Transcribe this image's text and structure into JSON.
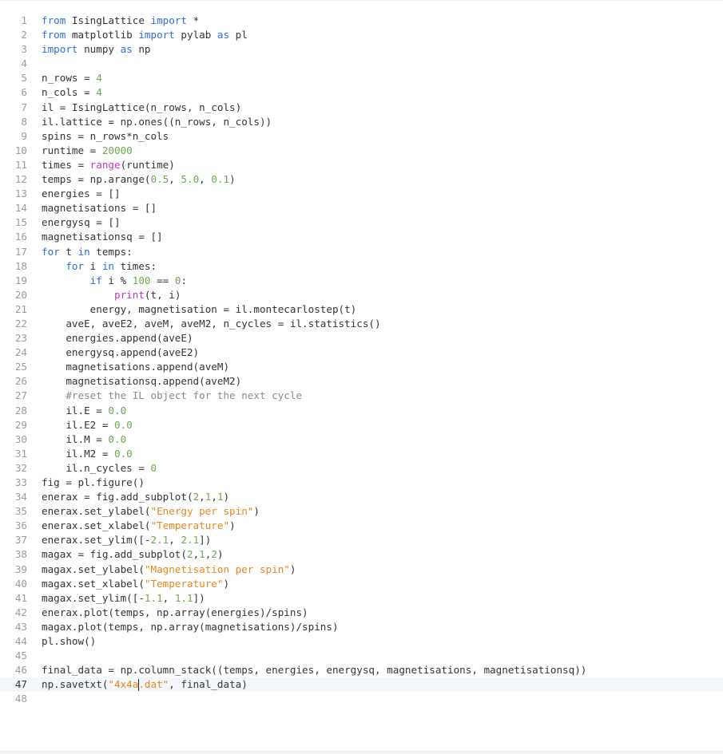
{
  "editor": {
    "cursor_line": 47,
    "colors": {
      "keyword": "#2d6cdf",
      "builtin": "#c535c5",
      "number": "#6aa84f",
      "string": "#e8861b",
      "comment": "#8a8a8a",
      "text": "#333333",
      "line_number": "#9a9a9a",
      "active_line_bg": "#f3f6fa"
    },
    "lines": [
      [
        [
          "kw",
          "from"
        ],
        [
          "t",
          " IsingLattice "
        ],
        [
          "kw",
          "import"
        ],
        [
          "t",
          " *"
        ]
      ],
      [
        [
          "kw",
          "from"
        ],
        [
          "t",
          " matplotlib "
        ],
        [
          "kw",
          "import"
        ],
        [
          "t",
          " pylab "
        ],
        [
          "kw",
          "as"
        ],
        [
          "t",
          " pl"
        ]
      ],
      [
        [
          "kw",
          "import"
        ],
        [
          "t",
          " numpy "
        ],
        [
          "kw",
          "as"
        ],
        [
          "t",
          " np"
        ]
      ],
      [],
      [
        [
          "t",
          "n_rows = "
        ],
        [
          "num",
          "4"
        ]
      ],
      [
        [
          "t",
          "n_cols = "
        ],
        [
          "num",
          "4"
        ]
      ],
      [
        [
          "t",
          "il = IsingLattice(n_rows, n_cols)"
        ]
      ],
      [
        [
          "t",
          "il.lattice = np.ones((n_rows, n_cols))"
        ]
      ],
      [
        [
          "t",
          "spins = n_rows*n_cols"
        ]
      ],
      [
        [
          "t",
          "runtime = "
        ],
        [
          "num",
          "20000"
        ]
      ],
      [
        [
          "t",
          "times = "
        ],
        [
          "bi",
          "range"
        ],
        [
          "t",
          "(runtime)"
        ]
      ],
      [
        [
          "t",
          "temps = np.arange("
        ],
        [
          "num",
          "0.5"
        ],
        [
          "t",
          ", "
        ],
        [
          "num",
          "5.0"
        ],
        [
          "t",
          ", "
        ],
        [
          "num",
          "0.1"
        ],
        [
          "t",
          ")"
        ]
      ],
      [
        [
          "t",
          "energies = []"
        ]
      ],
      [
        [
          "t",
          "magnetisations = []"
        ]
      ],
      [
        [
          "t",
          "energysq = []"
        ]
      ],
      [
        [
          "t",
          "magnetisationsq = []"
        ]
      ],
      [
        [
          "kw",
          "for"
        ],
        [
          "t",
          " t "
        ],
        [
          "kw",
          "in"
        ],
        [
          "t",
          " temps:"
        ]
      ],
      [
        [
          "t",
          "    "
        ],
        [
          "kw",
          "for"
        ],
        [
          "t",
          " i "
        ],
        [
          "kw",
          "in"
        ],
        [
          "t",
          " times:"
        ]
      ],
      [
        [
          "t",
          "        "
        ],
        [
          "kw",
          "if"
        ],
        [
          "t",
          " i % "
        ],
        [
          "num",
          "100"
        ],
        [
          "t",
          " == "
        ],
        [
          "num",
          "0"
        ],
        [
          "t",
          ":"
        ]
      ],
      [
        [
          "t",
          "            "
        ],
        [
          "bi",
          "print"
        ],
        [
          "t",
          "(t, i)"
        ]
      ],
      [
        [
          "t",
          "        energy, magnetisation = il.montecarlostep(t)"
        ]
      ],
      [
        [
          "t",
          "    aveE, aveE2, aveM, aveM2, n_cycles = il.statistics()"
        ]
      ],
      [
        [
          "t",
          "    energies.append(aveE)"
        ]
      ],
      [
        [
          "t",
          "    energysq.append(aveE2)"
        ]
      ],
      [
        [
          "t",
          "    magnetisations.append(aveM)"
        ]
      ],
      [
        [
          "t",
          "    magnetisationsq.append(aveM2)"
        ]
      ],
      [
        [
          "t",
          "    "
        ],
        [
          "cmt",
          "#reset the IL object for the next cycle"
        ]
      ],
      [
        [
          "t",
          "    il.E = "
        ],
        [
          "num",
          "0.0"
        ]
      ],
      [
        [
          "t",
          "    il.E2 = "
        ],
        [
          "num",
          "0.0"
        ]
      ],
      [
        [
          "t",
          "    il.M = "
        ],
        [
          "num",
          "0.0"
        ]
      ],
      [
        [
          "t",
          "    il.M2 = "
        ],
        [
          "num",
          "0.0"
        ]
      ],
      [
        [
          "t",
          "    il.n_cycles = "
        ],
        [
          "num",
          "0"
        ]
      ],
      [
        [
          "t",
          "fig = pl.figure()"
        ]
      ],
      [
        [
          "t",
          "enerax = fig.add_subplot("
        ],
        [
          "num",
          "2"
        ],
        [
          "t",
          ","
        ],
        [
          "num",
          "1"
        ],
        [
          "t",
          ","
        ],
        [
          "num",
          "1"
        ],
        [
          "t",
          ")"
        ]
      ],
      [
        [
          "t",
          "enerax.set_ylabel("
        ],
        [
          "str",
          "\"Energy per spin\""
        ],
        [
          "t",
          ")"
        ]
      ],
      [
        [
          "t",
          "enerax.set_xlabel("
        ],
        [
          "str",
          "\"Temperature\""
        ],
        [
          "t",
          ")"
        ]
      ],
      [
        [
          "t",
          "enerax.set_ylim([-"
        ],
        [
          "num",
          "2.1"
        ],
        [
          "t",
          ", "
        ],
        [
          "num",
          "2.1"
        ],
        [
          "t",
          "])"
        ]
      ],
      [
        [
          "t",
          "magax = fig.add_subplot("
        ],
        [
          "num",
          "2"
        ],
        [
          "t",
          ","
        ],
        [
          "num",
          "1"
        ],
        [
          "t",
          ","
        ],
        [
          "num",
          "2"
        ],
        [
          "t",
          ")"
        ]
      ],
      [
        [
          "t",
          "magax.set_ylabel("
        ],
        [
          "str",
          "\"Magnetisation per spin\""
        ],
        [
          "t",
          ")"
        ]
      ],
      [
        [
          "t",
          "magax.set_xlabel("
        ],
        [
          "str",
          "\"Temperature\""
        ],
        [
          "t",
          ")"
        ]
      ],
      [
        [
          "t",
          "magax.set_ylim([-"
        ],
        [
          "num",
          "1.1"
        ],
        [
          "t",
          ", "
        ],
        [
          "num",
          "1.1"
        ],
        [
          "t",
          "])"
        ]
      ],
      [
        [
          "t",
          "enerax.plot(temps, np.array(energies)/spins)"
        ]
      ],
      [
        [
          "t",
          "magax.plot(temps, np.array(magnetisations)/spins)"
        ]
      ],
      [
        [
          "t",
          "pl.show()"
        ]
      ],
      [],
      [
        [
          "t",
          "final_data = np.column_stack((temps, energies, energysq, magnetisations, magnetisationsq))"
        ]
      ],
      [
        [
          "t",
          "np.savetxt("
        ],
        [
          "str",
          "\"4x4a"
        ],
        [
          "cursor",
          ""
        ],
        [
          "str",
          ".dat\""
        ],
        [
          "t",
          ", final_data)"
        ]
      ],
      []
    ]
  }
}
